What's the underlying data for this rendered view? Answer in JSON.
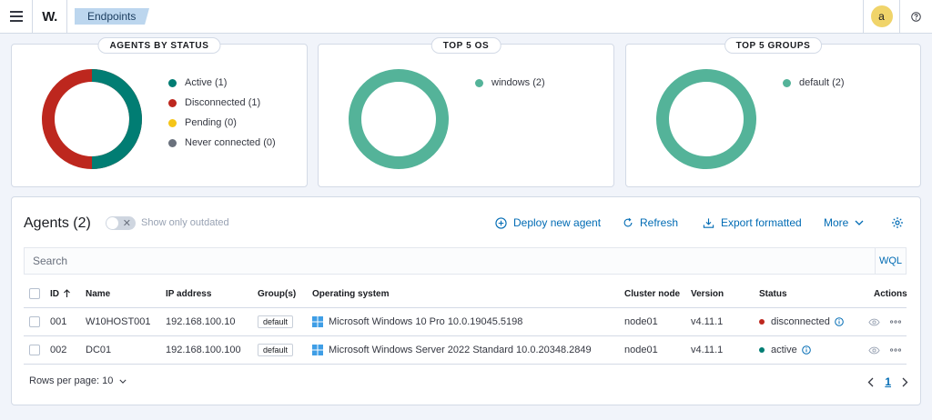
{
  "header": {
    "logo": "W.",
    "breadcrumb": "Endpoints",
    "avatar_initial": "a"
  },
  "panels": {
    "status": {
      "title": "AGENTS BY STATUS",
      "legend": [
        {
          "label": "Active (1)",
          "color": "#017d73"
        },
        {
          "label": "Disconnected (1)",
          "color": "#bd271e"
        },
        {
          "label": "Pending (0)",
          "color": "#f5c518"
        },
        {
          "label": "Never connected (0)",
          "color": "#6a717d"
        }
      ]
    },
    "os": {
      "title": "TOP 5 OS",
      "legend": [
        {
          "label": "windows (2)",
          "color": "#54b399"
        }
      ]
    },
    "groups": {
      "title": "TOP 5 GROUPS",
      "legend": [
        {
          "label": "default (2)",
          "color": "#54b399"
        }
      ]
    }
  },
  "agents": {
    "title": "Agents (2)",
    "toggle_label": "Show only outdated",
    "actions": {
      "deploy": "Deploy new agent",
      "refresh": "Refresh",
      "export": "Export formatted",
      "more": "More"
    },
    "search_placeholder": "Search",
    "wql": "WQL",
    "columns": {
      "id": "ID",
      "name": "Name",
      "ip": "IP address",
      "groups": "Group(s)",
      "os": "Operating system",
      "node": "Cluster node",
      "version": "Version",
      "status": "Status",
      "actions": "Actions"
    },
    "rows": [
      {
        "id": "001",
        "name": "W10HOST001",
        "ip": "192.168.100.10",
        "group": "default",
        "os": "Microsoft Windows 10 Pro 10.0.19045.5198",
        "node": "node01",
        "version": "v4.11.1",
        "status": "disconnected",
        "status_color": "#bd271e"
      },
      {
        "id": "002",
        "name": "DC01",
        "ip": "192.168.100.100",
        "group": "default",
        "os": "Microsoft Windows Server 2022 Standard 10.0.20348.2849",
        "node": "node01",
        "version": "v4.11.1",
        "status": "active",
        "status_color": "#017d73"
      }
    ],
    "rows_per_page": "Rows per page: 10",
    "current_page": "1"
  },
  "colors": {
    "accent": "#006bb4",
    "active": "#017d73",
    "disconnected": "#bd271e",
    "donut_single": "#54b399"
  }
}
